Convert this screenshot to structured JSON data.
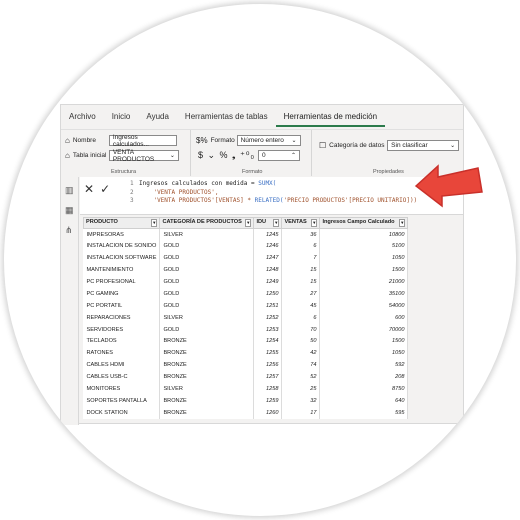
{
  "ribbon": {
    "tabs": [
      "Archivo",
      "Inicio",
      "Ayuda",
      "Herramientas de tablas",
      "Herramientas de medición"
    ],
    "estructura": {
      "nombre_label": "Nombre",
      "nombre_value": "Ingresos calculados...",
      "tabla_label": "Tabla inicial",
      "tabla_value": "VENTA PRODUCTOS",
      "group_label": "Estructura"
    },
    "formato": {
      "formato_label": "Formato",
      "formato_value": "Número entero",
      "symbols": "$ ⌄ % ❟ ⁺⁰₀",
      "decimals_value": "0",
      "group_label": "Formato"
    },
    "propiedades": {
      "categoria_label": "Categoría de datos",
      "categoria_value": "Sin clasificar",
      "group_label": "Propiedades"
    }
  },
  "formula": {
    "cancel_icon": "close-icon",
    "commit_icon": "check-icon",
    "line1_num": "1",
    "line1": "Ingresos calculados con medida = ",
    "line1_fn": "SUMX(",
    "line2_num": "2",
    "line2": "'VENTA PRODUCTOS',",
    "line3_num": "3",
    "line3_a": "'VENTA PRODUCTOS'[VENTAS] * ",
    "line3_fn": "RELATED(",
    "line3_b": "'PRECIO PRODUCTOS'[PRECIO UNITARIO]))"
  },
  "table": {
    "headers": [
      "PRODUCTO",
      "CATEGORÍA DE PRODUCTOS",
      "IDU",
      "VENTAS",
      "Ingresos Campo Calculado"
    ],
    "rows": [
      [
        "IMPRESORAS",
        "SILVER",
        "1245",
        "36",
        "10800"
      ],
      [
        "INSTALACION DE SONIDO",
        "GOLD",
        "1246",
        "6",
        "5100"
      ],
      [
        "INSTALACION SOFTWARE",
        "GOLD",
        "1247",
        "7",
        "1050"
      ],
      [
        "MANTENIMIENTO",
        "GOLD",
        "1248",
        "15",
        "1500"
      ],
      [
        "PC PROFESIONAL",
        "GOLD",
        "1249",
        "15",
        "21000"
      ],
      [
        "PC GAMING",
        "GOLD",
        "1250",
        "27",
        "35100"
      ],
      [
        "PC PORTATIL",
        "GOLD",
        "1251",
        "45",
        "54000"
      ],
      [
        "REPARACIONES",
        "SILVER",
        "1252",
        "6",
        "600"
      ],
      [
        "SERVIDORES",
        "GOLD",
        "1253",
        "70",
        "70000"
      ],
      [
        "TECLADOS",
        "BRONZE",
        "1254",
        "50",
        "1500"
      ],
      [
        "RATONES",
        "BRONZE",
        "1255",
        "42",
        "1050"
      ],
      [
        "CABLES HDMI",
        "BRONZE",
        "1256",
        "74",
        "592"
      ],
      [
        "CABLES USB-C",
        "BRONZE",
        "1257",
        "52",
        "208"
      ],
      [
        "MONITORES",
        "SILVER",
        "1258",
        "25",
        "8750"
      ],
      [
        "SOPORTES PANTALLA",
        "BRONZE",
        "1259",
        "32",
        "640"
      ],
      [
        "DOCK STATION",
        "BRONZE",
        "1260",
        "17",
        "595"
      ]
    ]
  },
  "colors": {
    "accent_green": "#2b7a4b",
    "arrow_red": "#e8463a"
  }
}
